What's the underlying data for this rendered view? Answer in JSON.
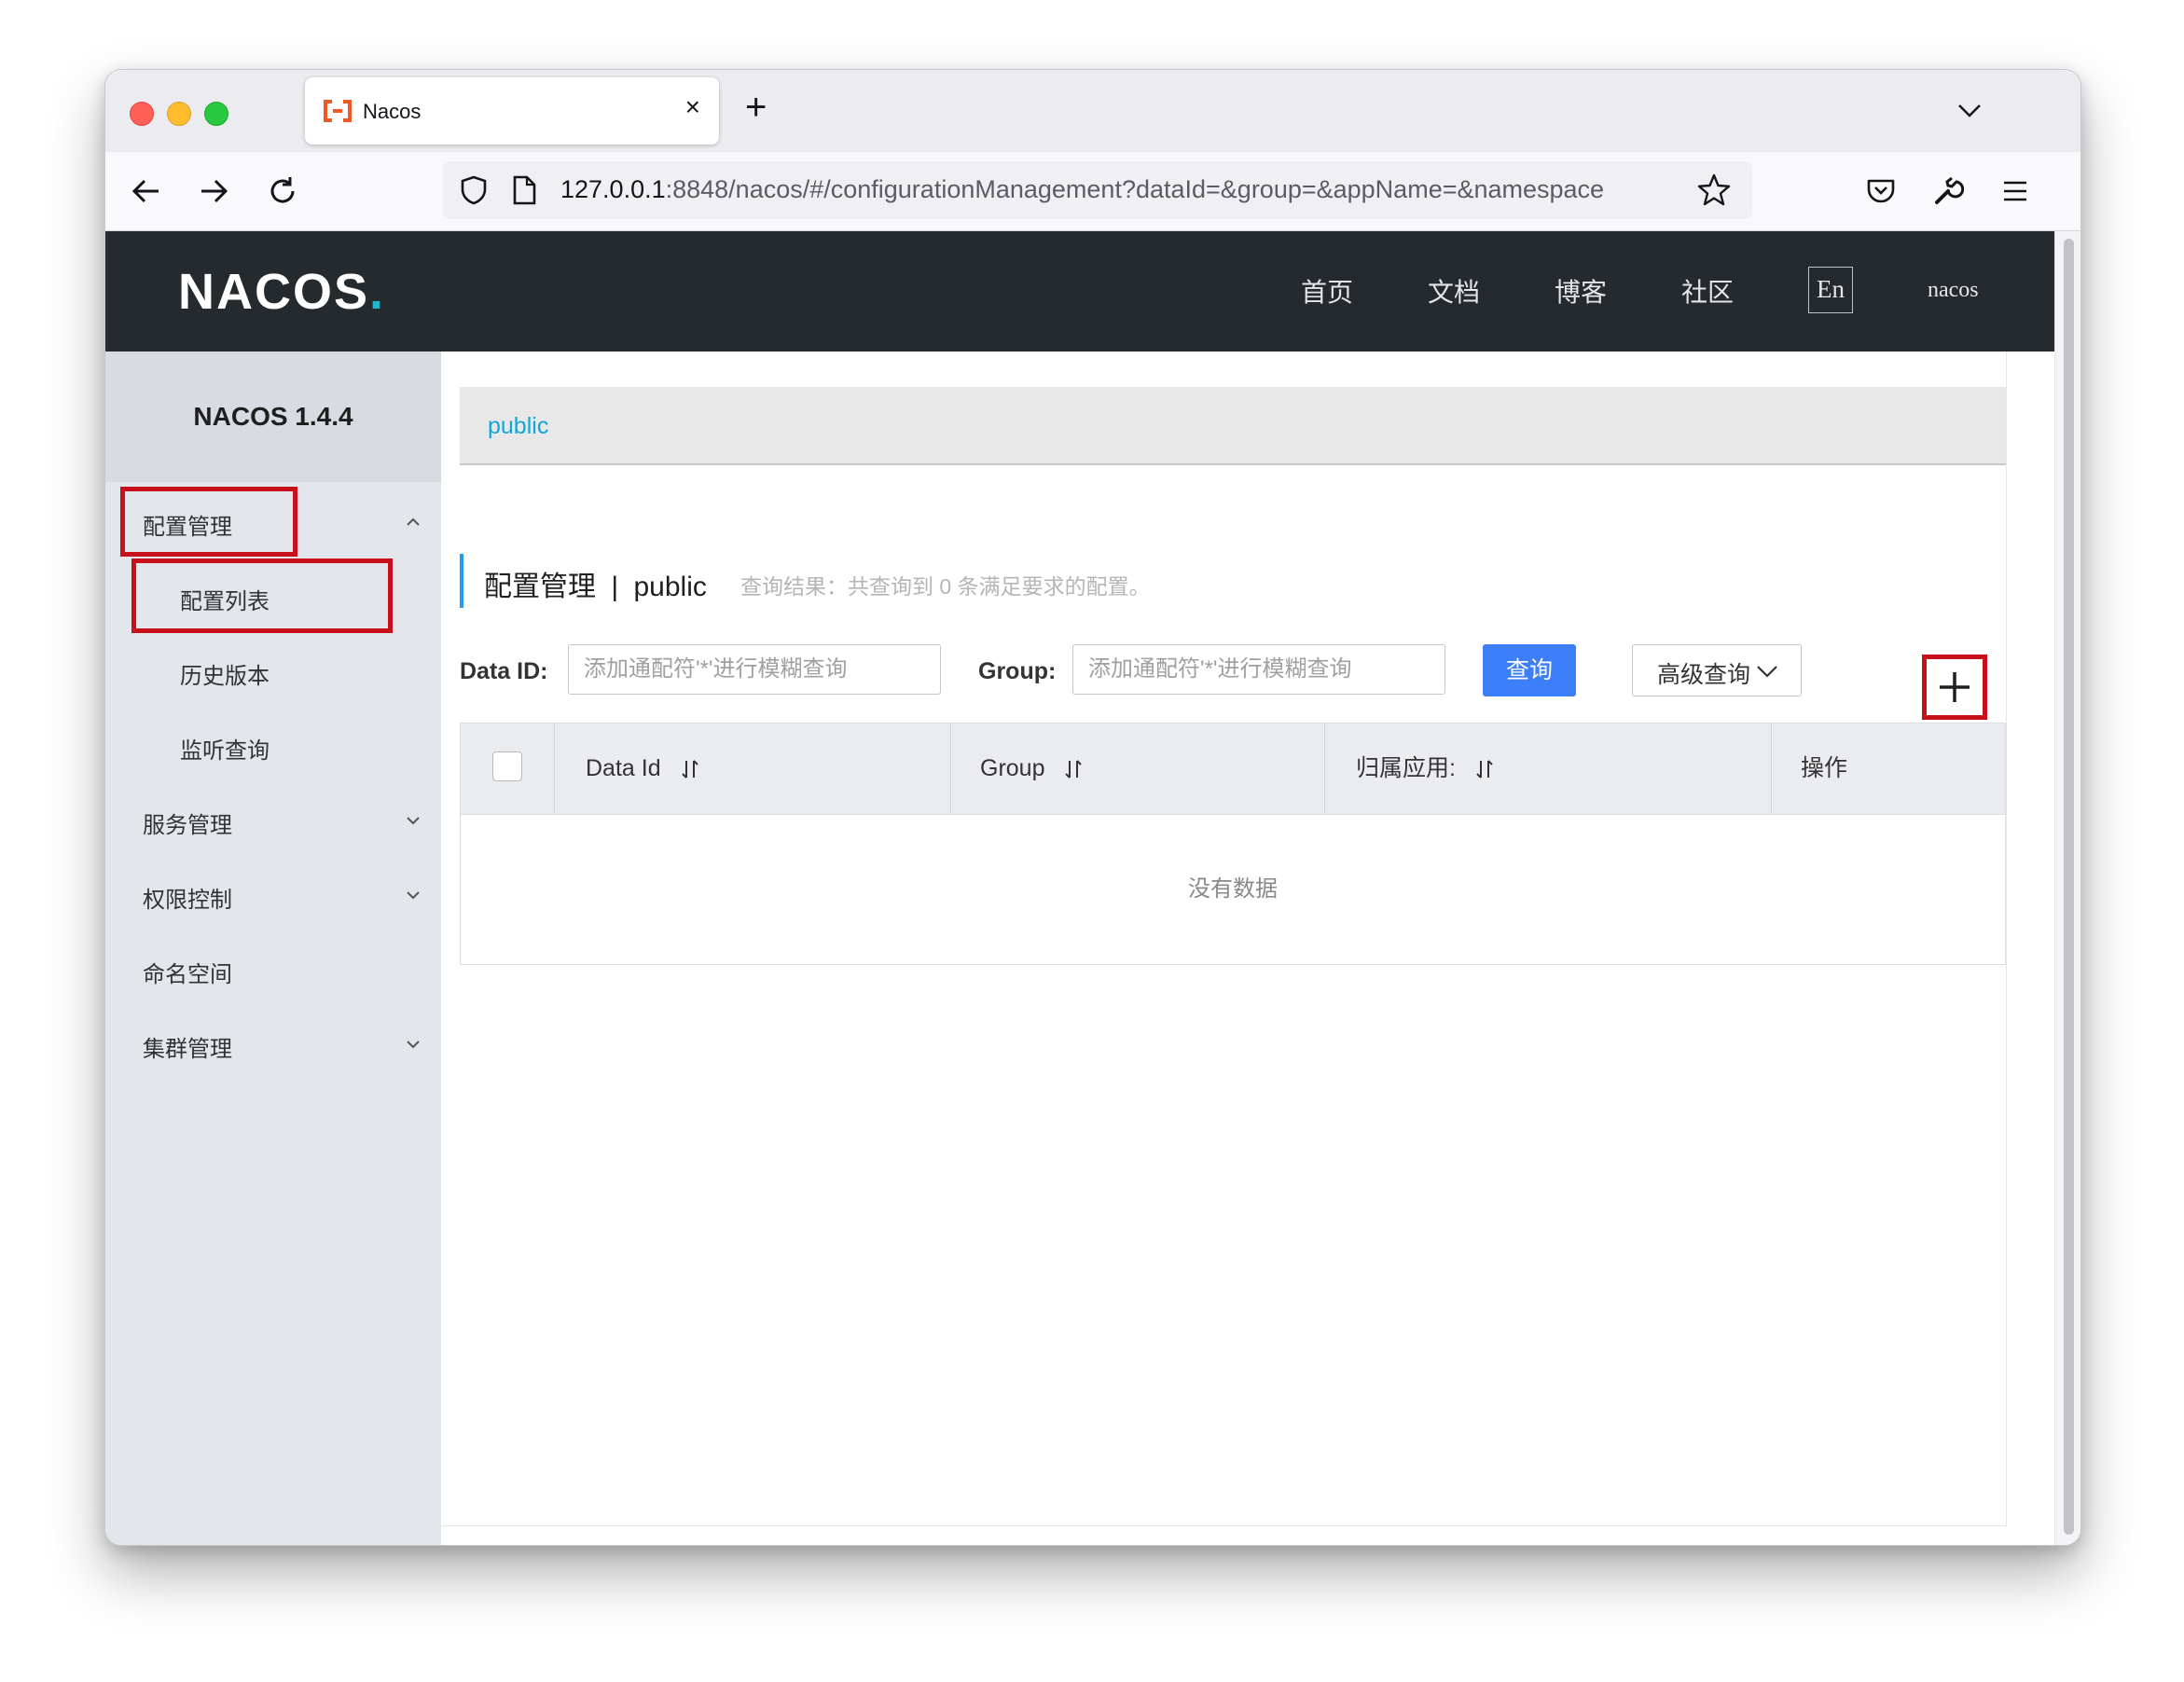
{
  "browser": {
    "tab_title": "Nacos",
    "tab_close": "×",
    "new_tab": "+",
    "url_host": "127.0.0.1",
    "url_rest": ":8848/nacos/#/configurationManagement?dataId=&group=&appName=&namespace"
  },
  "header": {
    "logo_main": "NACOS",
    "logo_dot": ".",
    "nav": [
      "首页",
      "文档",
      "博客",
      "社区"
    ],
    "lang": "En",
    "user": "nacos"
  },
  "sidebar": {
    "version": "NACOS 1.4.4",
    "menu": {
      "config_mgmt": "配置管理",
      "config_list": "配置列表",
      "history": "历史版本",
      "listen_query": "监听查询",
      "service_mgmt": "服务管理",
      "auth_control": "权限控制",
      "namespace": "命名空间",
      "cluster_mgmt": "集群管理"
    }
  },
  "main": {
    "namespace_link": "public",
    "title": "配置管理",
    "title_sep": "|",
    "title_ns": "public",
    "query_result": "查询结果：共查询到 0 条满足要求的配置。",
    "data_id_label": "Data ID:",
    "data_id_placeholder": "添加通配符'*'进行模糊查询",
    "group_label": "Group:",
    "group_placeholder": "添加通配符'*'进行模糊查询",
    "query_button": "查询",
    "advanced_button": "高级查询",
    "table": {
      "columns": [
        "Data Id",
        "Group",
        "归属应用:",
        "操作"
      ],
      "empty_text": "没有数据"
    }
  },
  "colors": {
    "header_bg": "#252a2f",
    "accent_blue": "#3d7efa",
    "link_blue": "#15a6d6",
    "highlight_red": "#c8101a",
    "sidebar_bg": "#e3e6ea"
  }
}
